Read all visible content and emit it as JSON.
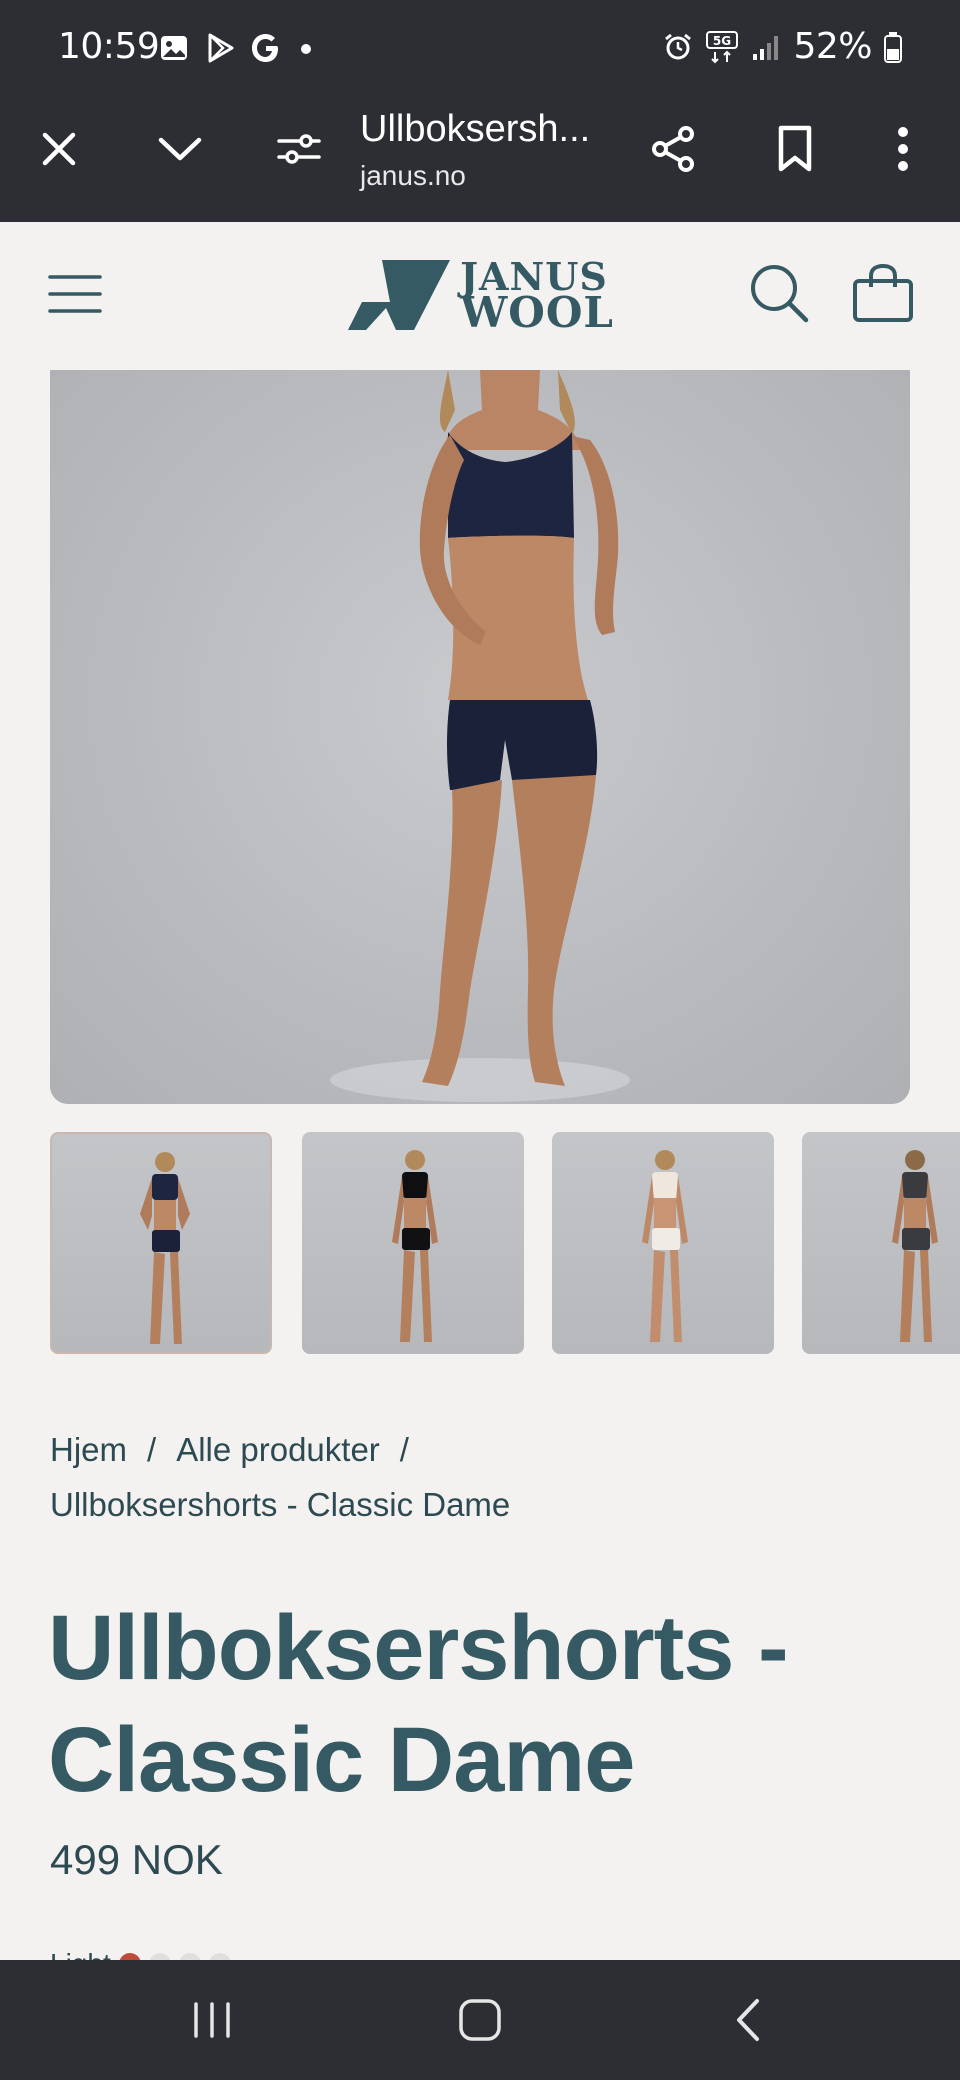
{
  "status_bar": {
    "time": "10:59",
    "battery": "52%",
    "network": "5G"
  },
  "browser": {
    "tab_title": "Ullboksersh...",
    "url": "janus.no"
  },
  "site": {
    "logo_line1": "JANUS",
    "logo_line2": "WOOL",
    "brand_color": "#355a63"
  },
  "gallery": {
    "thumbnails": [
      {
        "outfit": "navy"
      },
      {
        "outfit": "black"
      },
      {
        "outfit": "white"
      },
      {
        "outfit": "charcoal"
      }
    ]
  },
  "breadcrumb": {
    "items": [
      "Hjem",
      "Alle produkter",
      "Ullboksershorts - Classic Dame"
    ],
    "separator": "/"
  },
  "product": {
    "title": "Ullboksershorts - Classic Dame",
    "price": "499 NOK",
    "color_label": "Light",
    "swatches": [
      "#c04a3a",
      "#e2dedc",
      "#e2dedc",
      "#e2dedc"
    ]
  }
}
